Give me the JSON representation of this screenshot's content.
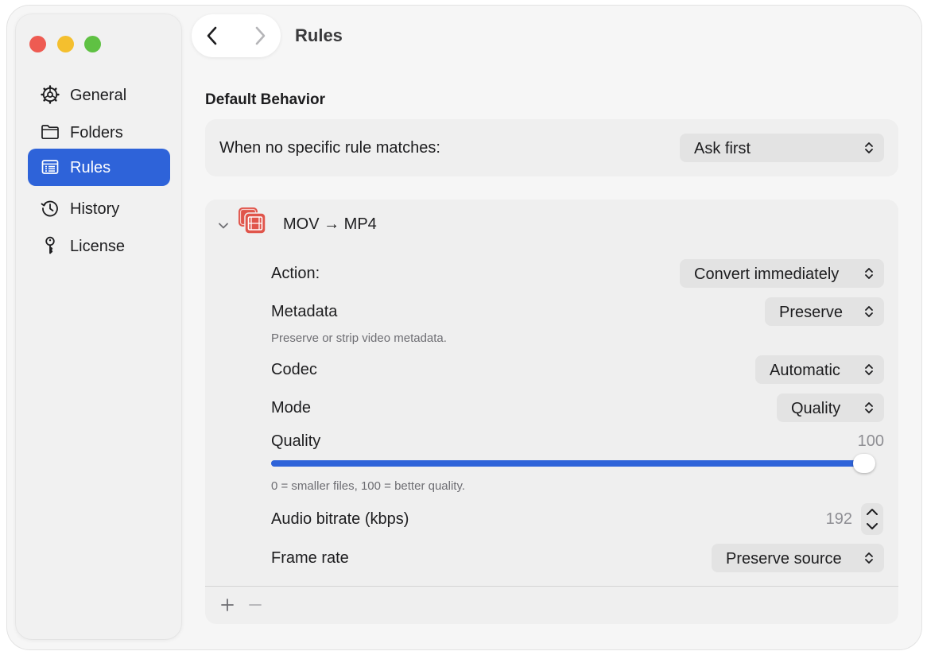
{
  "window": {
    "title": "Rules"
  },
  "sidebar": {
    "items": [
      {
        "label": "General",
        "icon": "gear-icon",
        "active": false
      },
      {
        "label": "Folders",
        "icon": "folder-icon",
        "active": false
      },
      {
        "label": "Rules",
        "icon": "rules-list-icon",
        "active": true
      },
      {
        "label": "History",
        "icon": "history-clock-icon",
        "active": false
      },
      {
        "label": "License",
        "icon": "key-icon",
        "active": false
      }
    ]
  },
  "default_behavior": {
    "heading": "Default Behavior",
    "label": "When no specific rule matches:",
    "value": "Ask first"
  },
  "rule": {
    "title": "MOV → MP4",
    "icon": "video-file-icon",
    "expanded": true,
    "action": {
      "label": "Action:",
      "value": "Convert immediately"
    },
    "metadata": {
      "label": "Metadata",
      "value": "Preserve",
      "help": "Preserve or strip video metadata."
    },
    "codec": {
      "label": "Codec",
      "value": "Automatic"
    },
    "mode": {
      "label": "Mode",
      "value": "Quality"
    },
    "quality": {
      "label": "Quality",
      "value": "100",
      "min": 0,
      "max": 100,
      "help": "0 = smaller files, 100 = better quality."
    },
    "audio_bitrate": {
      "label": "Audio bitrate (kbps)",
      "value": "192"
    },
    "frame_rate": {
      "label": "Frame rate",
      "value": "Preserve source"
    }
  },
  "colors": {
    "accent": "#2e63d9",
    "close": "#ee5b52",
    "minimize": "#f4bf2e",
    "zoom": "#5fc143",
    "rule_icon": "#e0554b"
  }
}
